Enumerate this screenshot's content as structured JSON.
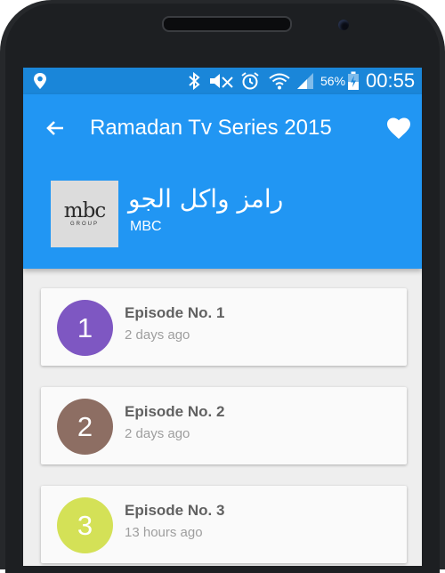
{
  "status_bar": {
    "battery_percent": "56%",
    "time": "00:55",
    "icons": [
      "location-icon",
      "bluetooth-icon",
      "mute-icon",
      "alarm-icon",
      "wifi-icon",
      "signal-icon",
      "battery-charging-icon"
    ]
  },
  "app_bar": {
    "title": "Ramadan Tv Series 2015",
    "series_name": "رامز واكل الجو",
    "channel": "MBC",
    "logo_text": "mbc",
    "logo_subtext": "GROUP",
    "color": "#2196f3"
  },
  "episodes": [
    {
      "number": "1",
      "title": "Episode No. 1",
      "time": "2 days ago",
      "color": "#7e57c2"
    },
    {
      "number": "2",
      "title": "Episode No. 2",
      "time": "2 days ago",
      "color": "#8d6e63"
    },
    {
      "number": "3",
      "title": "Episode No. 3",
      "time": "13 hours ago",
      "color": "#d4e157"
    }
  ]
}
